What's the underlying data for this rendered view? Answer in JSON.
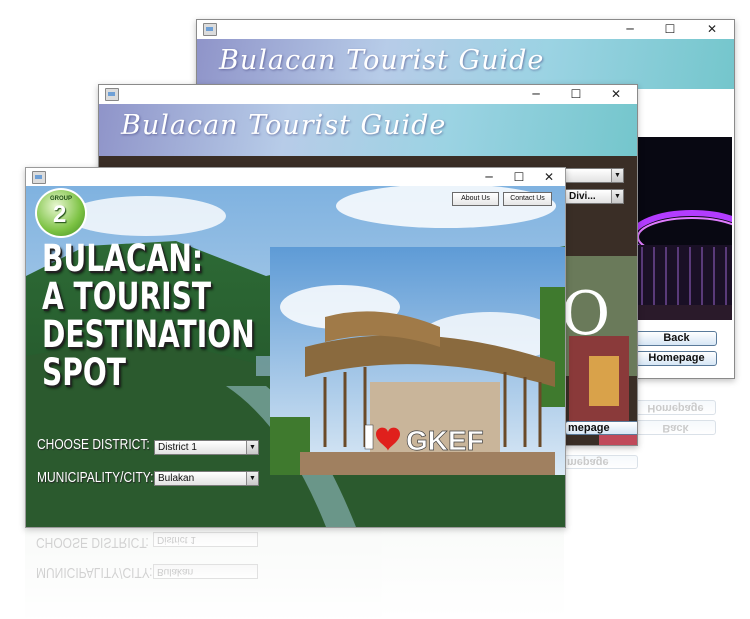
{
  "window_back": {
    "banner_title": "Bulacan Tourist Guide",
    "controls": {
      "minimize": "─",
      "maximize": "☐",
      "close": "✕"
    },
    "back_button": "Back",
    "homepage_button": "Homepage"
  },
  "window_middle": {
    "banner_title": "Bulacan Tourist Guide",
    "controls": {
      "minimize": "─",
      "maximize": "☐",
      "close": "✕"
    },
    "combo_top": "",
    "combo_district": "Divi...",
    "homepage_button_partial": "mepage"
  },
  "window_front": {
    "controls": {
      "minimize": "─",
      "maximize": "☐",
      "close": "✕"
    },
    "logo_text_top": "GROUP",
    "logo_number": "2",
    "about_button": "About Us",
    "contact_button": "Contact Us",
    "headline_lines": [
      "BULACAN:",
      "A TOURIST",
      "DESTINATION",
      "SPOT"
    ],
    "choose_district_label": "CHOOSE DISTRICT:",
    "district_selected": "District 1",
    "municipality_label": "MUNICIPALITY/CITY:",
    "municipality_selected": "Bulakan",
    "sign_text_left": "I",
    "sign_text_right": "GKEF",
    "heart_icon": "heart-icon"
  },
  "colors": {
    "banner_start": "#8f94c9",
    "banner_end": "#74c6cc",
    "accent_red": "#e0201c",
    "stadium_purple": "#b33cff"
  }
}
